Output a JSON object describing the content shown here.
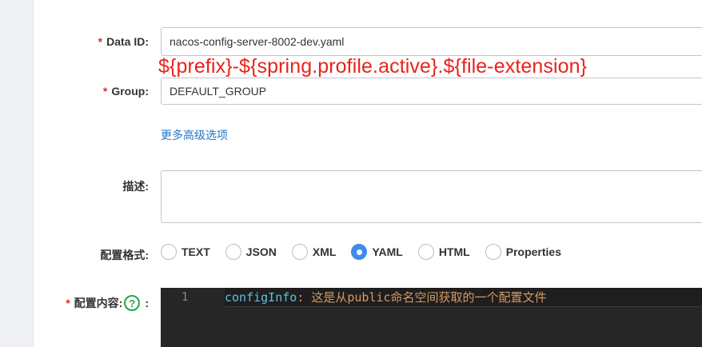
{
  "form": {
    "data_id": {
      "required_mark": "*",
      "label": "Data ID:",
      "value": "nacos-config-server-8002-dev.yaml"
    },
    "annotation": "${prefix}-${spring.profile.active}.${file-extension}",
    "group": {
      "required_mark": "*",
      "label": "Group:",
      "value": "DEFAULT_GROUP"
    },
    "more_options_link": "更多高级选项",
    "description": {
      "label": "描述:",
      "value": ""
    },
    "format": {
      "label": "配置格式:",
      "options": [
        "TEXT",
        "JSON",
        "XML",
        "YAML",
        "HTML",
        "Properties"
      ],
      "selected": "YAML"
    },
    "content": {
      "required_mark": "*",
      "label": "配置内容:",
      "help_icon": "question-circle-icon",
      "label_suffix": ":",
      "line_number": "1",
      "code_key": "configInfo",
      "code_sep": ": ",
      "code_value": "这是从public命名空间获取的一个配置文件"
    }
  },
  "colors": {
    "required": "#e5292b",
    "annotation": "#e8231b",
    "link": "#2077c7",
    "radio_checked": "#3e8bea",
    "help_icon": "#21a94b",
    "editor_bg": "#262626"
  }
}
